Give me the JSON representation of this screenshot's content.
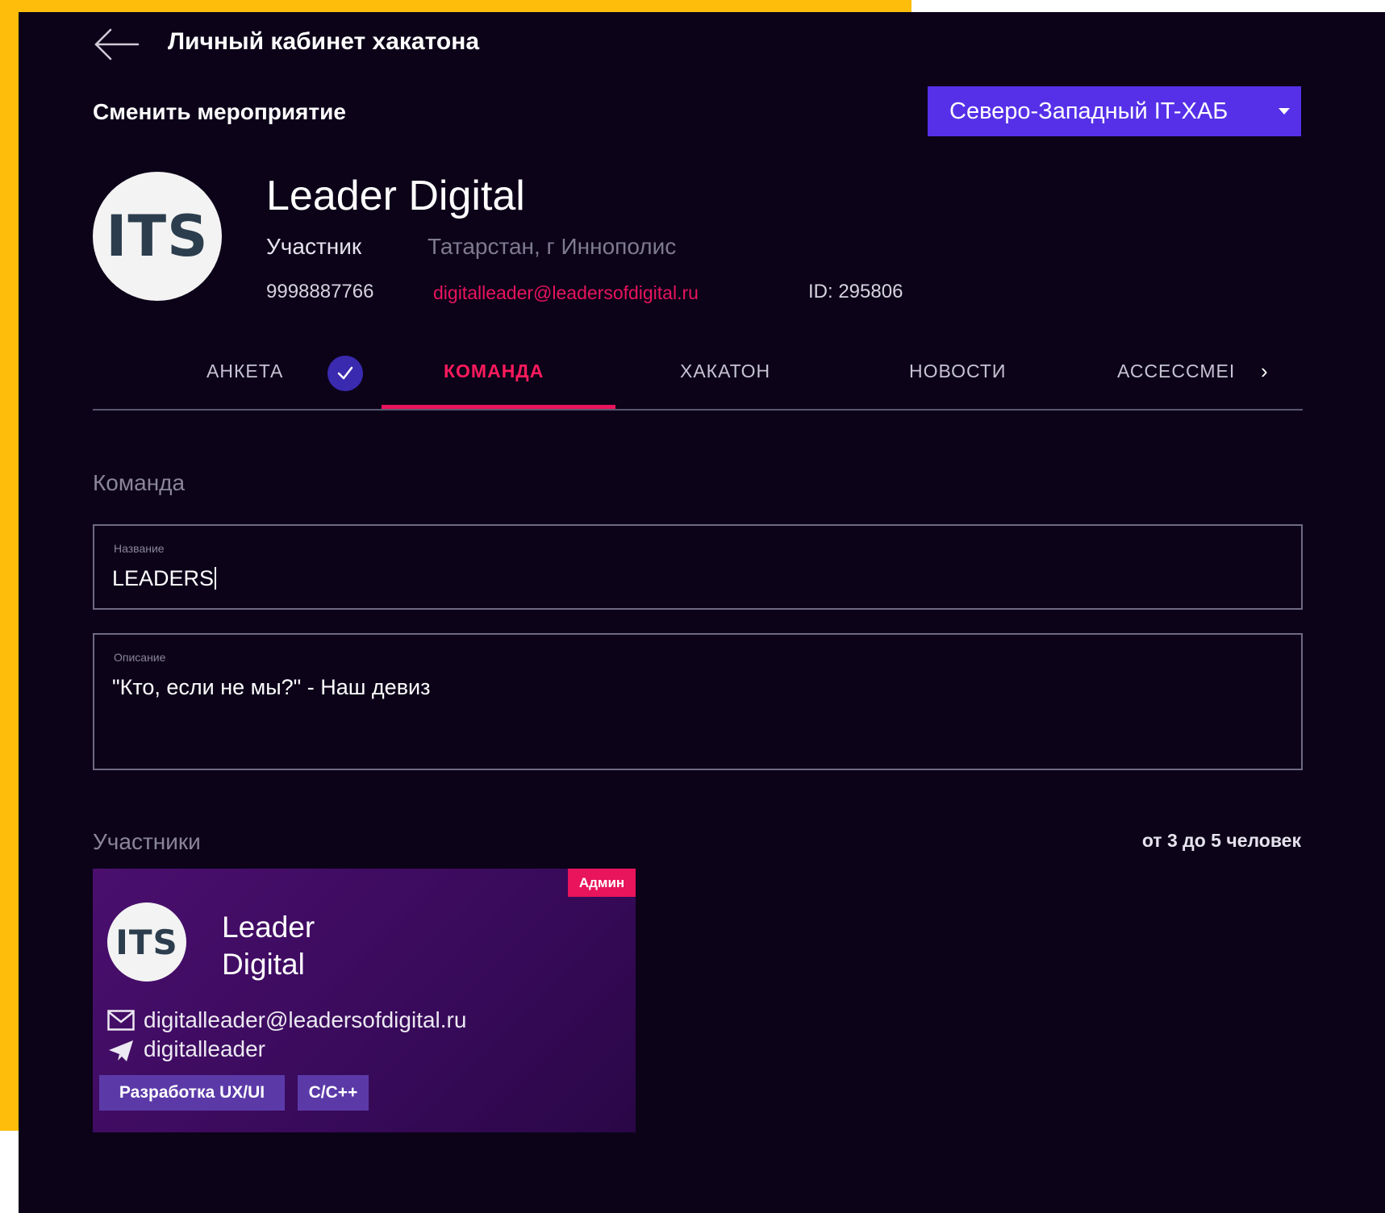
{
  "header": {
    "title": "Личный кабинет хакатона",
    "change_event_label": "Сменить мероприятие",
    "event_selected": "Северо-Западный IT-ХАБ"
  },
  "profile": {
    "logo_text": "ITS",
    "name": "Leader Digital",
    "role": "Участник",
    "location": "Татарстан, г Иннополис",
    "phone": "9998887766",
    "email": "digitalleader@leadersofdigital.ru",
    "id": "ID: 295806"
  },
  "tabs": [
    {
      "label": "АНКЕТА",
      "completed": true
    },
    {
      "label": "КОМАНДА",
      "active": true
    },
    {
      "label": "ХАКАТОН"
    },
    {
      "label": "НОВОСТИ"
    },
    {
      "label": "АССЕССМЕI"
    }
  ],
  "team": {
    "section_title": "Команда",
    "name_field": {
      "label": "Название",
      "value": "LEADERS"
    },
    "description_field": {
      "label": "Описание",
      "value": "\"Кто, если не мы?\" - Наш девиз"
    }
  },
  "members": {
    "title": "Участники",
    "size_note": "от 3 до 5 человек",
    "items": [
      {
        "badge": "Админ",
        "logo_text": "ITS",
        "name": "Leader Digital",
        "email": "digitalleader@leadersofdigital.ru",
        "telegram": "digitalleader",
        "tags": [
          "Разработка UX/UI",
          "C/C++"
        ]
      }
    ]
  },
  "colors": {
    "background": "#0c0319",
    "accent": "#5530e8",
    "active": "#e8145c",
    "card": "#4a0f6e",
    "frame": "#fdbd0a"
  },
  "icons": [
    "arrow-left-icon",
    "caret-down-icon",
    "check-icon",
    "chevron-right-icon",
    "mail-icon",
    "telegram-icon"
  ]
}
